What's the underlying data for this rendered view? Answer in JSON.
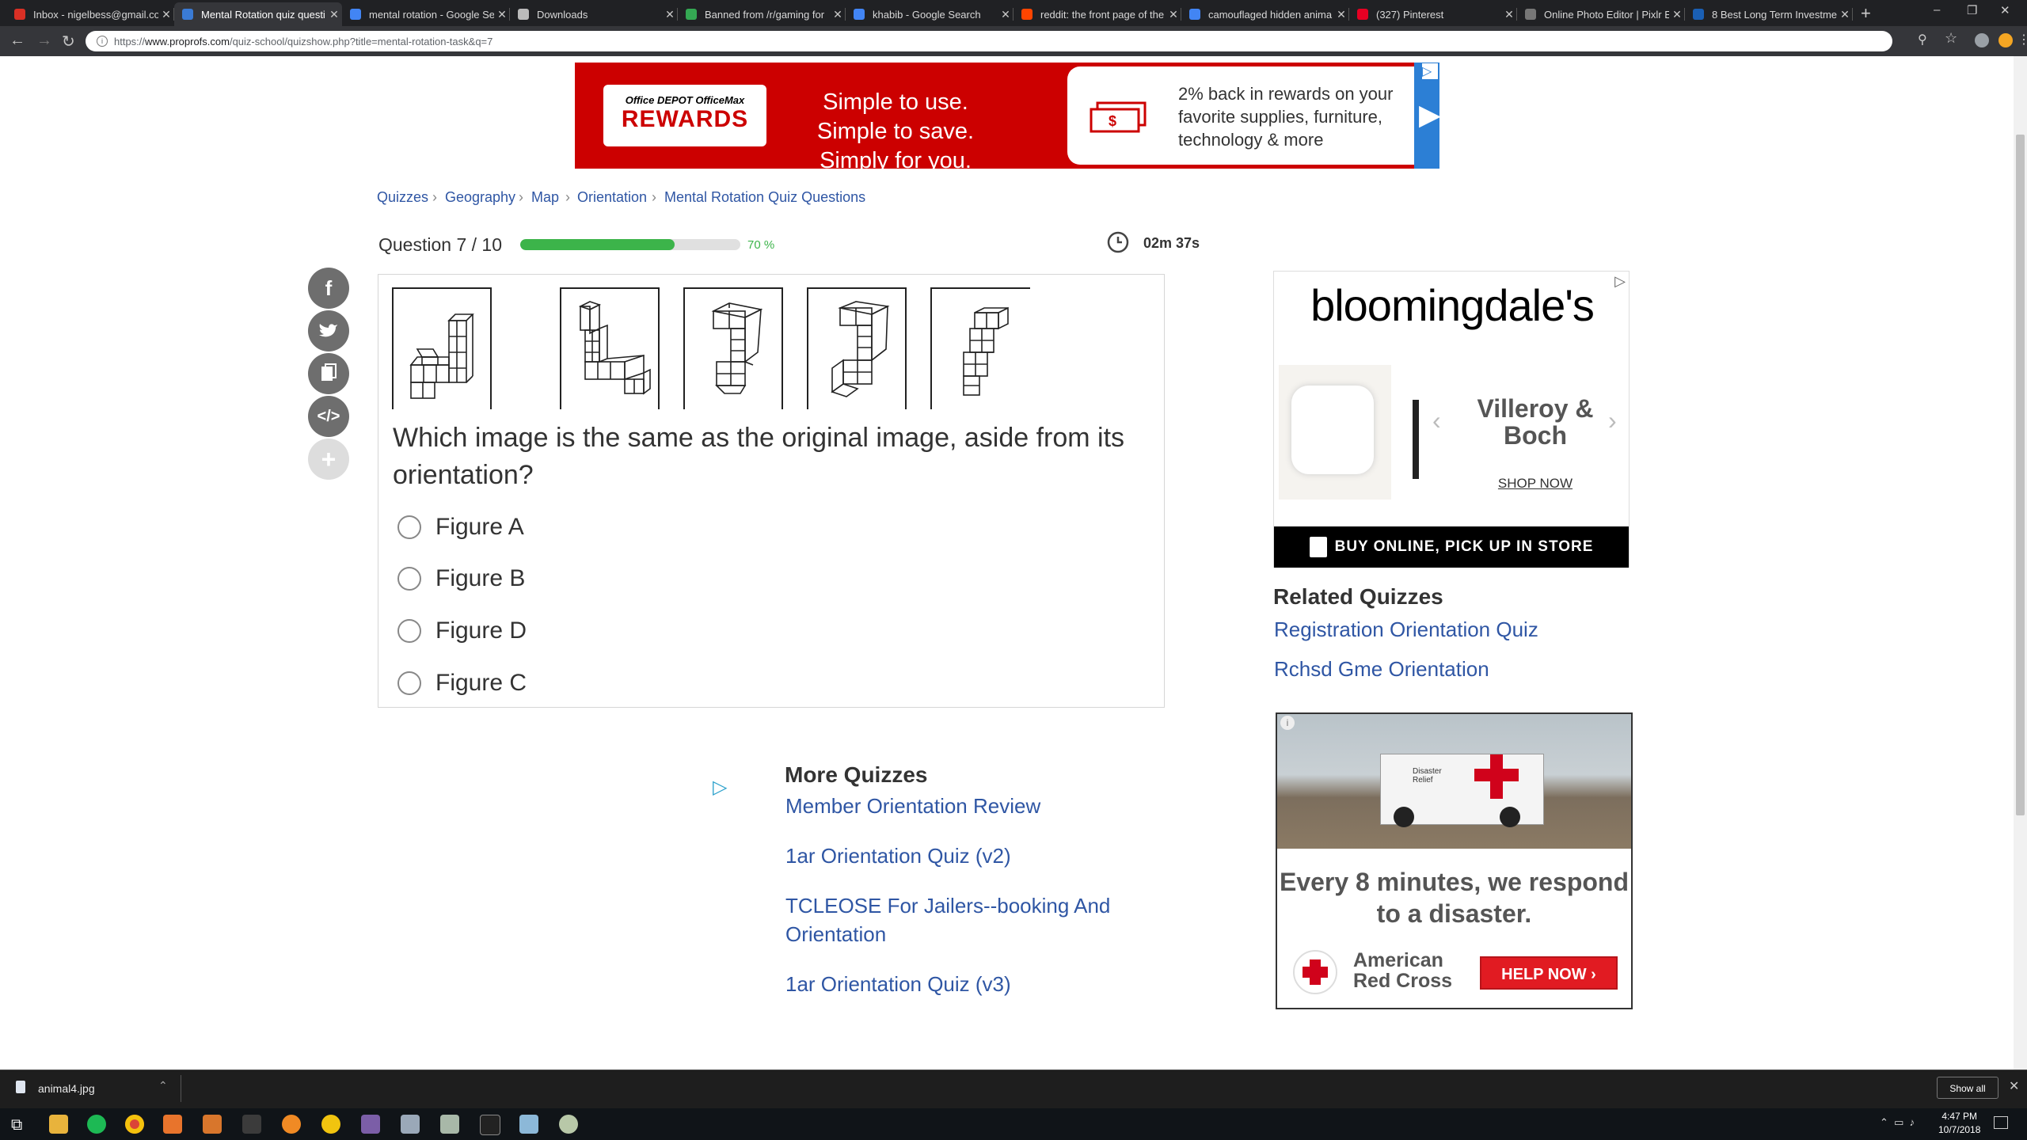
{
  "browser": {
    "tabs": [
      {
        "title": "Inbox - nigelbess@gmail.co",
        "color": "#d93025",
        "active": false
      },
      {
        "title": "Mental Rotation quiz questi",
        "color": "#3a7bd5",
        "active": true
      },
      {
        "title": "mental rotation - Google Se",
        "color": "#4285f4",
        "active": false
      },
      {
        "title": "Downloads",
        "color": "#bbbbbb",
        "active": false
      },
      {
        "title": "Banned from /r/gaming for",
        "color": "#34a853",
        "active": false
      },
      {
        "title": "khabib - Google Search",
        "color": "#4285f4",
        "active": false
      },
      {
        "title": "reddit: the front page of the",
        "color": "#ff4500",
        "active": false
      },
      {
        "title": "camouflaged hidden anima",
        "color": "#4285f4",
        "active": false
      },
      {
        "title": "(327) Pinterest",
        "color": "#e60023",
        "active": false
      },
      {
        "title": "Online Photo Editor | Pixlr E",
        "color": "#777777",
        "active": false
      },
      {
        "title": "8 Best Long Term Investme",
        "color": "#1a5fb4",
        "active": false
      }
    ],
    "url_scheme": "https://",
    "url_host": "www.proprofs.com",
    "url_path": "/quiz-school/quizshow.php?title=mental-rotation-task&q=7"
  },
  "ad_top": {
    "logo_line1": "Office DEPOT OfficeMax",
    "logo_line2": "REWARDS",
    "tagline": "Simple to use. Simple to save. Simply for you.",
    "offer": "2% back in rewards on your favorite supplies, furniture, technology & more"
  },
  "breadcrumbs": [
    "Quizzes",
    "Geography",
    "Map",
    "Orientation",
    "Mental Rotation Quiz Questions"
  ],
  "breadcrumb_separator": "›",
  "quiz": {
    "question_count": "Question 7 / 10",
    "progress_percent": 70,
    "progress_label": "70 %",
    "timer": "02m 37s",
    "question": "Which image is the same as the original image, aside from its orientation?",
    "options": [
      "Figure A",
      "Figure B",
      "Figure D",
      "Figure C"
    ]
  },
  "share_icons": [
    "facebook-icon",
    "twitter-icon",
    "copy-icon",
    "embed-icon",
    "plus-icon"
  ],
  "more_quizzes": {
    "title": "More Quizzes",
    "links": [
      "Member Orientation Review",
      "1ar Orientation Quiz (v2)",
      "TCLEOSE For Jailers--booking And Orientation",
      "1ar Orientation Quiz (v3)"
    ]
  },
  "ad_bloomingdales": {
    "brand": "bloomingdale's",
    "product": "Villeroy & Boch",
    "cta": "SHOP NOW",
    "banner": "BUY ONLINE, PICK UP IN STORE"
  },
  "related_quizzes": {
    "title": "Related Quizzes",
    "links": [
      "Registration Orientation Quiz",
      "Rchsd Gme Orientation"
    ]
  },
  "ad_redcross": {
    "slogan": "Every 8 minutes, we respond to a disaster.",
    "org": "American Red Cross",
    "cta": "HELP NOW ›",
    "truck_label": "Disaster Relief"
  },
  "downloads": {
    "file": "animal4.jpg",
    "show_all": "Show all"
  },
  "taskbar": {
    "time": "4:47 PM",
    "date": "10/7/2018"
  },
  "colors": {
    "link": "#2f56a4",
    "progress": "#3cb44a",
    "ad_red": "#cc0000"
  }
}
